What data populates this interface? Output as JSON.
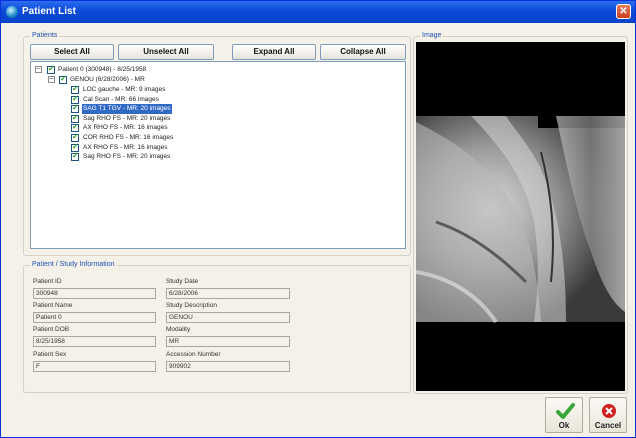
{
  "window": {
    "title": "Patient List",
    "close_glyph": "✕"
  },
  "patients_group": {
    "legend": "Patients",
    "buttons": {
      "select_all": "Select All",
      "unselect_all": "Unselect All",
      "expand_all": "Expand All",
      "collapse_all": "Collapse All"
    },
    "tree": {
      "patient": "Patient 0 (300948) - 8/25/1958",
      "study": "GENOU (6/28/2006) - MR",
      "series": [
        {
          "label": "LOC gauche - MR: 9 images",
          "selected": false
        },
        {
          "label": "Cal Scan - MR: 66 images",
          "selected": false
        },
        {
          "label": "SAG T1 TGV - MR: 20 images",
          "selected": true
        },
        {
          "label": "Sag RHO FS - MR: 20 images",
          "selected": false
        },
        {
          "label": "AX RHO FS - MR: 16 images",
          "selected": false
        },
        {
          "label": "COR RHO FS - MR: 16 images",
          "selected": false
        },
        {
          "label": "AX RHO FS - MR: 16 images",
          "selected": false
        },
        {
          "label": "Sag RHO FS - MR: 20 images",
          "selected": false
        }
      ]
    }
  },
  "info_group": {
    "legend": "Patient / Study Information",
    "patient_id": {
      "label": "Patient ID",
      "value": "300948"
    },
    "patient_name": {
      "label": "Patient Name",
      "value": "Patient 0"
    },
    "patient_dob": {
      "label": "Patient DOB",
      "value": "8/25/1958"
    },
    "patient_sex": {
      "label": "Patient Sex",
      "value": "F"
    },
    "study_date": {
      "label": "Study Date",
      "value": "6/28/2006"
    },
    "study_description": {
      "label": "Study Description",
      "value": "GENOU"
    },
    "modality": {
      "label": "Modality",
      "value": "MR"
    },
    "accession_number": {
      "label": "Accession Number",
      "value": "909902"
    }
  },
  "image_group": {
    "legend": "Image"
  },
  "footer": {
    "ok": "Ok",
    "cancel": "Cancel"
  },
  "colors": {
    "titlebar": "#0a4ad8",
    "selection": "#316ac5",
    "legend_text": "#1f4fb3",
    "ok_check": "#3aa63a",
    "cancel_icon": "#d02020"
  }
}
